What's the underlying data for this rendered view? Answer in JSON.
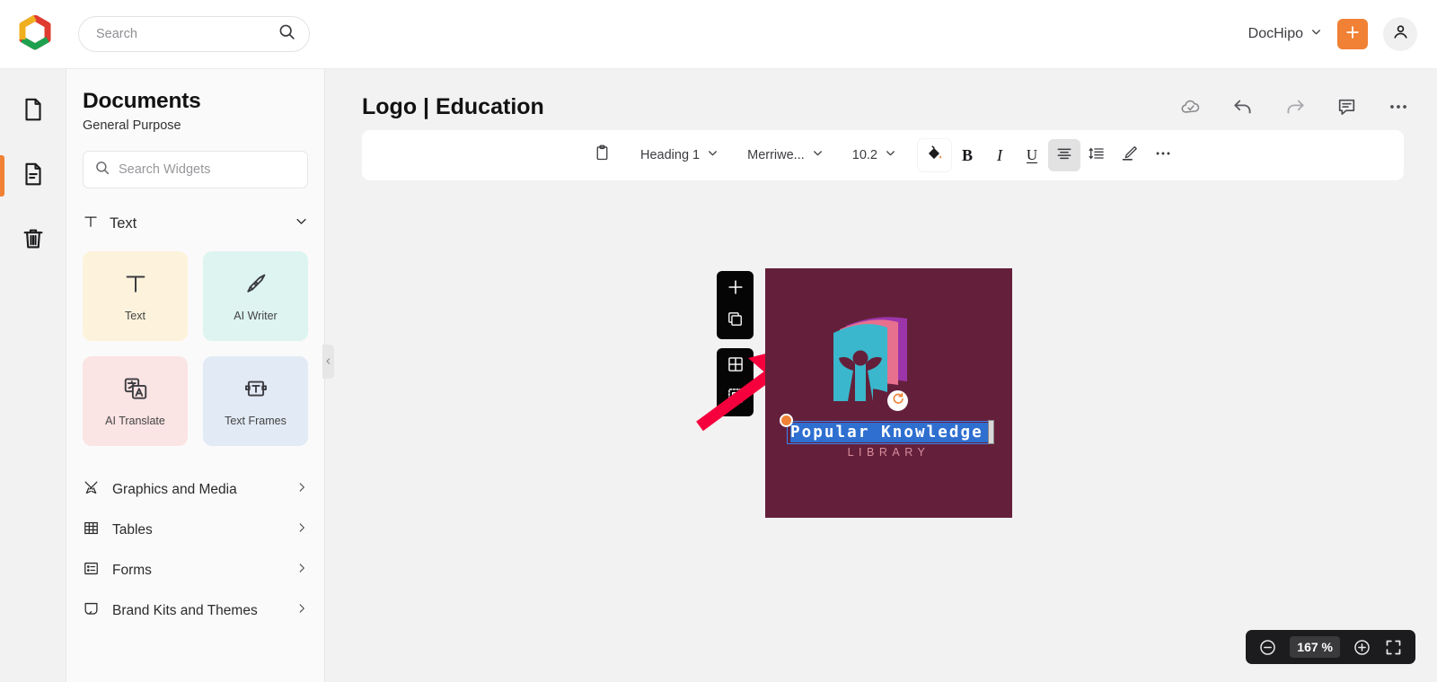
{
  "topbar": {
    "logo_icon": "dochipo-logo-icon",
    "search": {
      "value": "",
      "placeholder": "Search",
      "icon": "search-icon"
    },
    "workspace": {
      "label": "DocHipo",
      "chevron_icon": "chevron-down-icon"
    },
    "create_button": {
      "label": "+",
      "icon": "plus-icon",
      "color": "#f08135"
    },
    "account": {
      "icon": "user-avatar-icon"
    }
  },
  "rail": {
    "items": [
      {
        "name": "documents",
        "icon": "page-icon",
        "active": false
      },
      {
        "name": "pages",
        "icon": "page-lines-icon",
        "active": true
      },
      {
        "name": "trash",
        "icon": "trash-icon",
        "active": false
      }
    ],
    "active_color": "#f08135"
  },
  "panel": {
    "title": "Documents",
    "subtitle": "General Purpose",
    "search": {
      "value": "",
      "placeholder": "Search Widgets",
      "icon": "search-icon"
    },
    "section": {
      "label": "Text",
      "icon": "text-t-icon",
      "chevron_icon": "chevron-down-icon",
      "expanded": true
    },
    "widgets": [
      {
        "label": "Text",
        "icon": "text-t-icon",
        "bg": "#fdf3dc"
      },
      {
        "label": "AI Writer",
        "icon": "pen-nib-icon",
        "bg": "#ddf4f1"
      },
      {
        "label": "AI Translate",
        "icon": "translate-icon",
        "bg": "#fbe4e4"
      },
      {
        "label": "Text Frames",
        "icon": "text-frame-icon",
        "bg": "#e2eaf5"
      }
    ],
    "nav": [
      {
        "label": "Graphics and Media",
        "icon": "graphics-media-icon",
        "arrow_icon": "chevron-right-icon"
      },
      {
        "label": "Tables",
        "icon": "table-grid-icon",
        "arrow_icon": "chevron-right-icon"
      },
      {
        "label": "Forms",
        "icon": "form-icon",
        "arrow_icon": "chevron-right-icon"
      },
      {
        "label": "Brand Kits and Themes",
        "icon": "brand-kit-icon",
        "arrow_icon": "chevron-right-icon"
      }
    ],
    "collapse_handle_icon": "chevron-left-icon"
  },
  "document": {
    "title": "Logo | Education",
    "actions": [
      {
        "name": "saved-to-cloud",
        "icon": "cloud-check-icon"
      },
      {
        "name": "undo",
        "icon": "undo-arrow-icon"
      },
      {
        "name": "redo",
        "icon": "redo-arrow-icon"
      },
      {
        "name": "comments",
        "icon": "comment-icon"
      },
      {
        "name": "more-options",
        "icon": "ellipsis-icon"
      }
    ]
  },
  "format_toolbar": {
    "clipboard_icon": "clipboard-icon",
    "style": {
      "label": "Heading 1",
      "chevron_icon": "chevron-down-icon"
    },
    "font": {
      "label": "Merriwe...",
      "chevron_icon": "chevron-down-icon"
    },
    "size": {
      "label": "10.2",
      "chevron_icon": "chevron-down-icon"
    },
    "buttons": [
      {
        "name": "fill-color",
        "label": "",
        "icon": "paint-bucket-icon",
        "state": "white"
      },
      {
        "name": "bold",
        "label": "B",
        "icon": "bold-icon",
        "state": "off"
      },
      {
        "name": "italic",
        "label": "I",
        "icon": "italic-icon",
        "state": "off"
      },
      {
        "name": "underline",
        "label": "U",
        "icon": "underline-icon",
        "state": "off"
      },
      {
        "name": "align",
        "label": "",
        "icon": "align-center-icon",
        "state": "selected"
      },
      {
        "name": "line-spacing",
        "label": "",
        "icon": "line-spacing-icon",
        "state": "off"
      },
      {
        "name": "highlighter",
        "label": "",
        "icon": "highlighter-pen-icon",
        "state": "off"
      },
      {
        "name": "more",
        "label": "",
        "icon": "ellipsis-icon",
        "state": "off"
      }
    ]
  },
  "canvas": {
    "artboard": {
      "background": "#64203a"
    },
    "logo": {
      "book_colors": {
        "front": "#3ab7cc",
        "middle": "#e8708f",
        "back": "#9c35aa"
      },
      "person_color": "#3ab7cc"
    },
    "brand_name": {
      "text": "Popular Knowledge",
      "selected": true,
      "selection_color": "#2f6fd0",
      "outline_color": "#3b82f6",
      "handle_color": "#f08135"
    },
    "brand_sub": {
      "text": "LIBRARY",
      "color": "#d98d9e"
    },
    "rotate_badge_icon": "rotate-icon",
    "float_tools": [
      {
        "name": "add-element",
        "icon": "plus-icon"
      },
      {
        "name": "duplicate",
        "icon": "duplicate-icon"
      },
      {
        "name": "layout-grid",
        "icon": "grid-icon"
      },
      {
        "name": "crop-select",
        "icon": "crop-select-icon"
      }
    ],
    "annotation": {
      "type": "arrow",
      "color": "#f5003c"
    }
  },
  "zoom_bar": {
    "zoom_out_icon": "minus-circle-icon",
    "value": "167 %",
    "zoom_in_icon": "plus-circle-icon",
    "fit_icon": "fullscreen-icon"
  }
}
